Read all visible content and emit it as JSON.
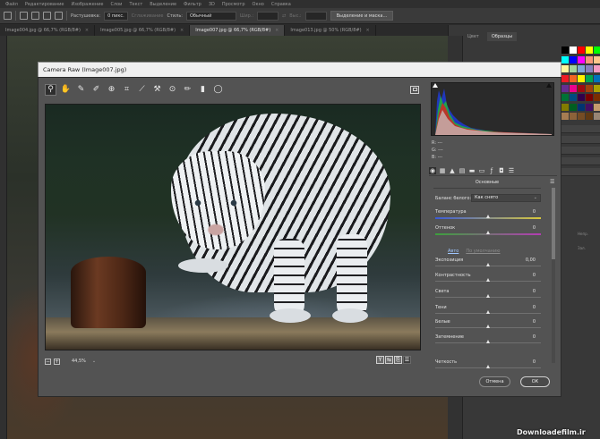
{
  "menubar": {
    "items": [
      "Файл",
      "Редактирование",
      "Изображение",
      "Слои",
      "Текст",
      "Выделение",
      "Фильтр",
      "3D",
      "Просмотр",
      "Окно",
      "Справка"
    ]
  },
  "options": {
    "feather_label": "Растушевка:",
    "feather_value": "0 пикс.",
    "antialias_label": "Сглаживание",
    "style_label": "Стиль:",
    "style_value": "Обычный",
    "width_label": "Шир.:",
    "height_label": "Выс.:",
    "select_mask_button": "Выделение и маска..."
  },
  "tabs": [
    {
      "label": "Image004.jpg @ 66,7% (RGB/8#)",
      "active": false
    },
    {
      "label": "Image005.jpg @ 66,7% (RGB/8#)",
      "active": false
    },
    {
      "label": "Image007.jpg @ 66,7% (RGB/8#)",
      "active": true
    },
    {
      "label": "Image013.jpg @ 50% (RGB/8#)",
      "active": false
    }
  ],
  "panels": {
    "tab_color": "Цвет",
    "tab_swatches": "Образцы",
    "swatch_colors": [
      "#000000",
      "#ffffff",
      "#ff0000",
      "#ffff00",
      "#00ff00",
      "#00ffff",
      "#0000ff",
      "#ff00ff",
      "#f7977a",
      "#fdc68a",
      "#fff79a",
      "#a3d39c",
      "#7ea7d8",
      "#8781bd",
      "#f49ac2",
      "#ed1c24",
      "#f26522",
      "#fff200",
      "#00a651",
      "#0072bc",
      "#662d91",
      "#ec008c",
      "#9e0b0f",
      "#a0410d",
      "#aba000",
      "#007236",
      "#004a80",
      "#32004b",
      "#790000",
      "#7b2e00",
      "#827b00",
      "#005e20",
      "#003471",
      "#440e62",
      "#c69c6d",
      "#a67c52",
      "#8c6239",
      "#754c24",
      "#603913",
      "#998675"
    ],
    "right_snippets": [
      "Непр.",
      "Зал."
    ]
  },
  "camera_raw": {
    "title": "Camera Raw (Image007.jpg)",
    "toolbar_icons": [
      "zoom-icon",
      "hand-icon",
      "eyedropper-icon",
      "color-sampler-icon",
      "target-adjust-icon",
      "crop-icon",
      "straighten-icon",
      "spot-removal-icon",
      "red-eye-icon",
      "adjustment-brush-icon",
      "graduated-filter-icon",
      "radial-filter-icon"
    ],
    "zoom_value": "44,5%",
    "histogram_readout": {
      "r": "R:  ---",
      "g": "G:  ---",
      "b": "B:  ---"
    },
    "panel_section": "Основные",
    "white_balance_label": "Баланс белого:",
    "white_balance_value": "Как снято",
    "sliders": [
      {
        "label": "Температура",
        "value": "0",
        "position": 0.5
      },
      {
        "label": "Оттенок",
        "value": "0",
        "position": 0.5
      },
      {
        "label": "Экспозиция",
        "value": "0,00",
        "position": 0.5
      },
      {
        "label": "Контрастность",
        "value": "0",
        "position": 0.5
      },
      {
        "label": "Света",
        "value": "0",
        "position": 0.5
      },
      {
        "label": "Тени",
        "value": "0",
        "position": 0.5
      },
      {
        "label": "Белые",
        "value": "0",
        "position": 0.5
      },
      {
        "label": "Затемнение",
        "value": "0",
        "position": 0.5
      },
      {
        "label": "Четкость",
        "value": "0",
        "position": 0.5
      }
    ],
    "auto_link": "Авто",
    "default_link": "По умолчанию",
    "cancel_button": "Отмена",
    "ok_button": "ОК"
  },
  "watermark": "Downloadefilm.ir",
  "colors": {
    "accent_link": "#9fc6ff",
    "dialog_bg": "#535353",
    "shell_bg": "#2b2b2b"
  }
}
